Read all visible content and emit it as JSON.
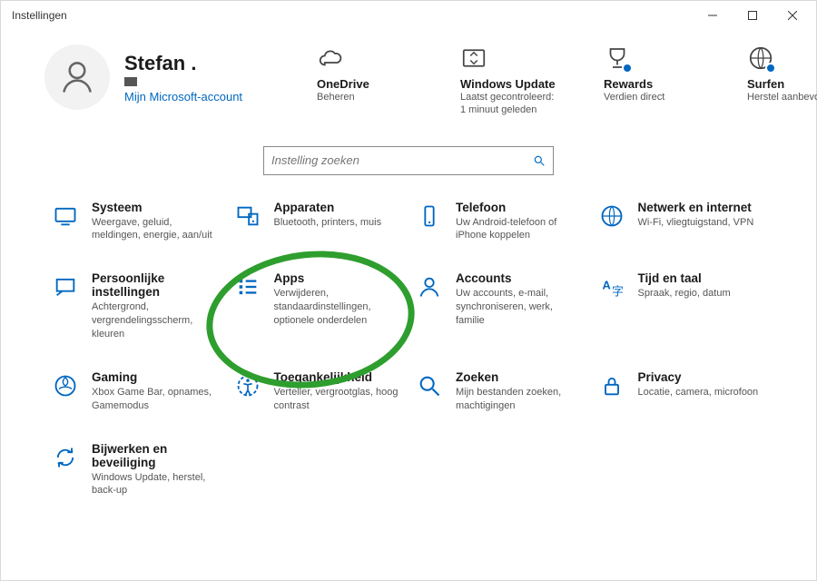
{
  "window": {
    "title": "Instellingen"
  },
  "profile": {
    "name": "Stefan .",
    "account_link": "Mijn Microsoft-account"
  },
  "status": {
    "onedrive": {
      "title": "OneDrive",
      "sub": "Beheren"
    },
    "update": {
      "title": "Windows Update",
      "sub": "Laatst gecontroleerd:\n1 minuut geleden"
    },
    "rewards": {
      "title": "Rewards",
      "sub": "Verdien direct"
    },
    "browse": {
      "title": "Surfen",
      "sub": "Herstel aanbevolen"
    }
  },
  "search": {
    "placeholder": "Instelling zoeken"
  },
  "categories": {
    "system": {
      "title": "Systeem",
      "desc": "Weergave, geluid, meldingen, energie, aan/uit"
    },
    "devices": {
      "title": "Apparaten",
      "desc": "Bluetooth, printers, muis"
    },
    "phone": {
      "title": "Telefoon",
      "desc": "Uw Android-telefoon of iPhone koppelen"
    },
    "network": {
      "title": "Netwerk en internet",
      "desc": "Wi-Fi, vliegtuigstand, VPN"
    },
    "personal": {
      "title": "Persoonlijke instellingen",
      "desc": "Achtergrond, vergrendelingsscherm, kleuren"
    },
    "apps": {
      "title": "Apps",
      "desc": "Verwijderen, standaardinstellingen, optionele onderdelen"
    },
    "accounts": {
      "title": "Accounts",
      "desc": "Uw accounts, e-mail, synchroniseren, werk, familie"
    },
    "time": {
      "title": "Tijd en taal",
      "desc": "Spraak, regio, datum"
    },
    "gaming": {
      "title": "Gaming",
      "desc": "Xbox Game Bar, opnames, Gamemodus"
    },
    "access": {
      "title": "Toegankelijkheid",
      "desc": "Verteller, vergrootglas, hoog contrast"
    },
    "searchc": {
      "title": "Zoeken",
      "desc": "Mijn bestanden zoeken, machtigingen"
    },
    "privacy": {
      "title": "Privacy",
      "desc": "Locatie, camera, microfoon"
    },
    "updatec": {
      "title": "Bijwerken en beveiliging",
      "desc": "Windows Update, herstel, back-up"
    }
  }
}
